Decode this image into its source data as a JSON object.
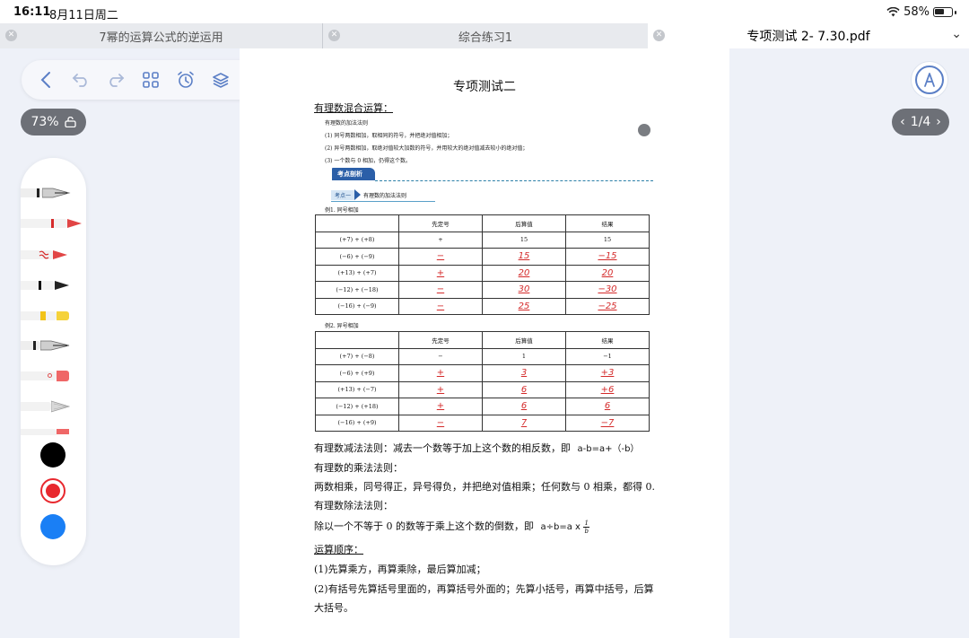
{
  "status": {
    "time": "16:11",
    "date": "8月11日周二",
    "battery": "58%",
    "wifi_icon": "wifi-icon",
    "battery_icon": "battery-icon"
  },
  "tabs": [
    {
      "label": "7幂的运算公式的逆运用",
      "active": false
    },
    {
      "label": "综合练习1",
      "active": false
    },
    {
      "label": "专项测试 2- 7.30.pdf",
      "active": true
    }
  ],
  "toolbar": {
    "icons": [
      "back-icon",
      "undo-icon",
      "redo-icon",
      "grid-icon",
      "alarm-icon",
      "layers-icon",
      "add-icon"
    ],
    "accent": "#5b7fc6",
    "dot_color": "#e0301e"
  },
  "zoom": {
    "label": "73%"
  },
  "pager": {
    "label": "1/4"
  },
  "palette": {
    "colors": [
      "#000000",
      "#e8282e",
      "#1a7ff5"
    ]
  },
  "document": {
    "title": "专项测试二",
    "section1": "有理数混合运算：",
    "rule_title": "有理数的加法法则",
    "rules": [
      "(1) 同号两数相加，取相同的符号，并把绝对值相加；",
      "(2) 异号两数相加，取绝对值较大加数的符号，并用较大的绝对值减去较小的绝对值；",
      "(3) 一个数与 0 相加，仍得这个数。"
    ],
    "banner": "考点剖析",
    "kd_box": "考点一",
    "kd_text": "有理数的加法法则",
    "ex1_label": "例1. 同号相加",
    "ex2_label": "例2. 异号相加",
    "table_headers": [
      "",
      "先定号",
      "后算值",
      "结果"
    ],
    "table1": [
      [
        "(+7) + (+8)",
        "+",
        "15",
        "15"
      ],
      [
        "(−6) + (−9)",
        "−",
        "15",
        "−15"
      ],
      [
        "(+13) + (+7)",
        "+",
        "20",
        "20"
      ],
      [
        "(−12) + (−18)",
        "−",
        "30",
        "−30"
      ],
      [
        "(−16) + (−9)",
        "−",
        "25",
        "−25"
      ]
    ],
    "table2": [
      [
        "(+7) + (−8)",
        "−",
        "1",
        "−1"
      ],
      [
        "(−6) + (+9)",
        "+",
        "3",
        "+3"
      ],
      [
        "(+13) + (−7)",
        "+",
        "6",
        "+6"
      ],
      [
        "(−12) + (+18)",
        "+",
        "6",
        "6"
      ],
      [
        "(−16) + (+9)",
        "−",
        "7",
        "−7"
      ]
    ],
    "subtract_rule": "有理数减法法则：减去一个数等于加上这个数的相反数，即",
    "subtract_formula": "a-b=a+（-b）",
    "multiply_title": "有理数的乘法法则：",
    "multiply_rule": "两数相乘，同号得正，异号得负，并把绝对值相乘；任何数与 0 相乘，都得 0.",
    "divide_title": "有理数除法法则：",
    "divide_rule": "除以一个不等于 0 的数等于乘上这个数的倒数，即",
    "divide_formula": "a÷b=a x",
    "frac_num": "1",
    "frac_den": "b",
    "order_title": "运算顺序：",
    "order1": "(1)先算乘方，再算乘除，最后算加减；",
    "order2": "(2)有括号先算括号里面的，再算括号外面的；先算小括号，再算中括号，后算",
    "order3": "大括号。"
  }
}
